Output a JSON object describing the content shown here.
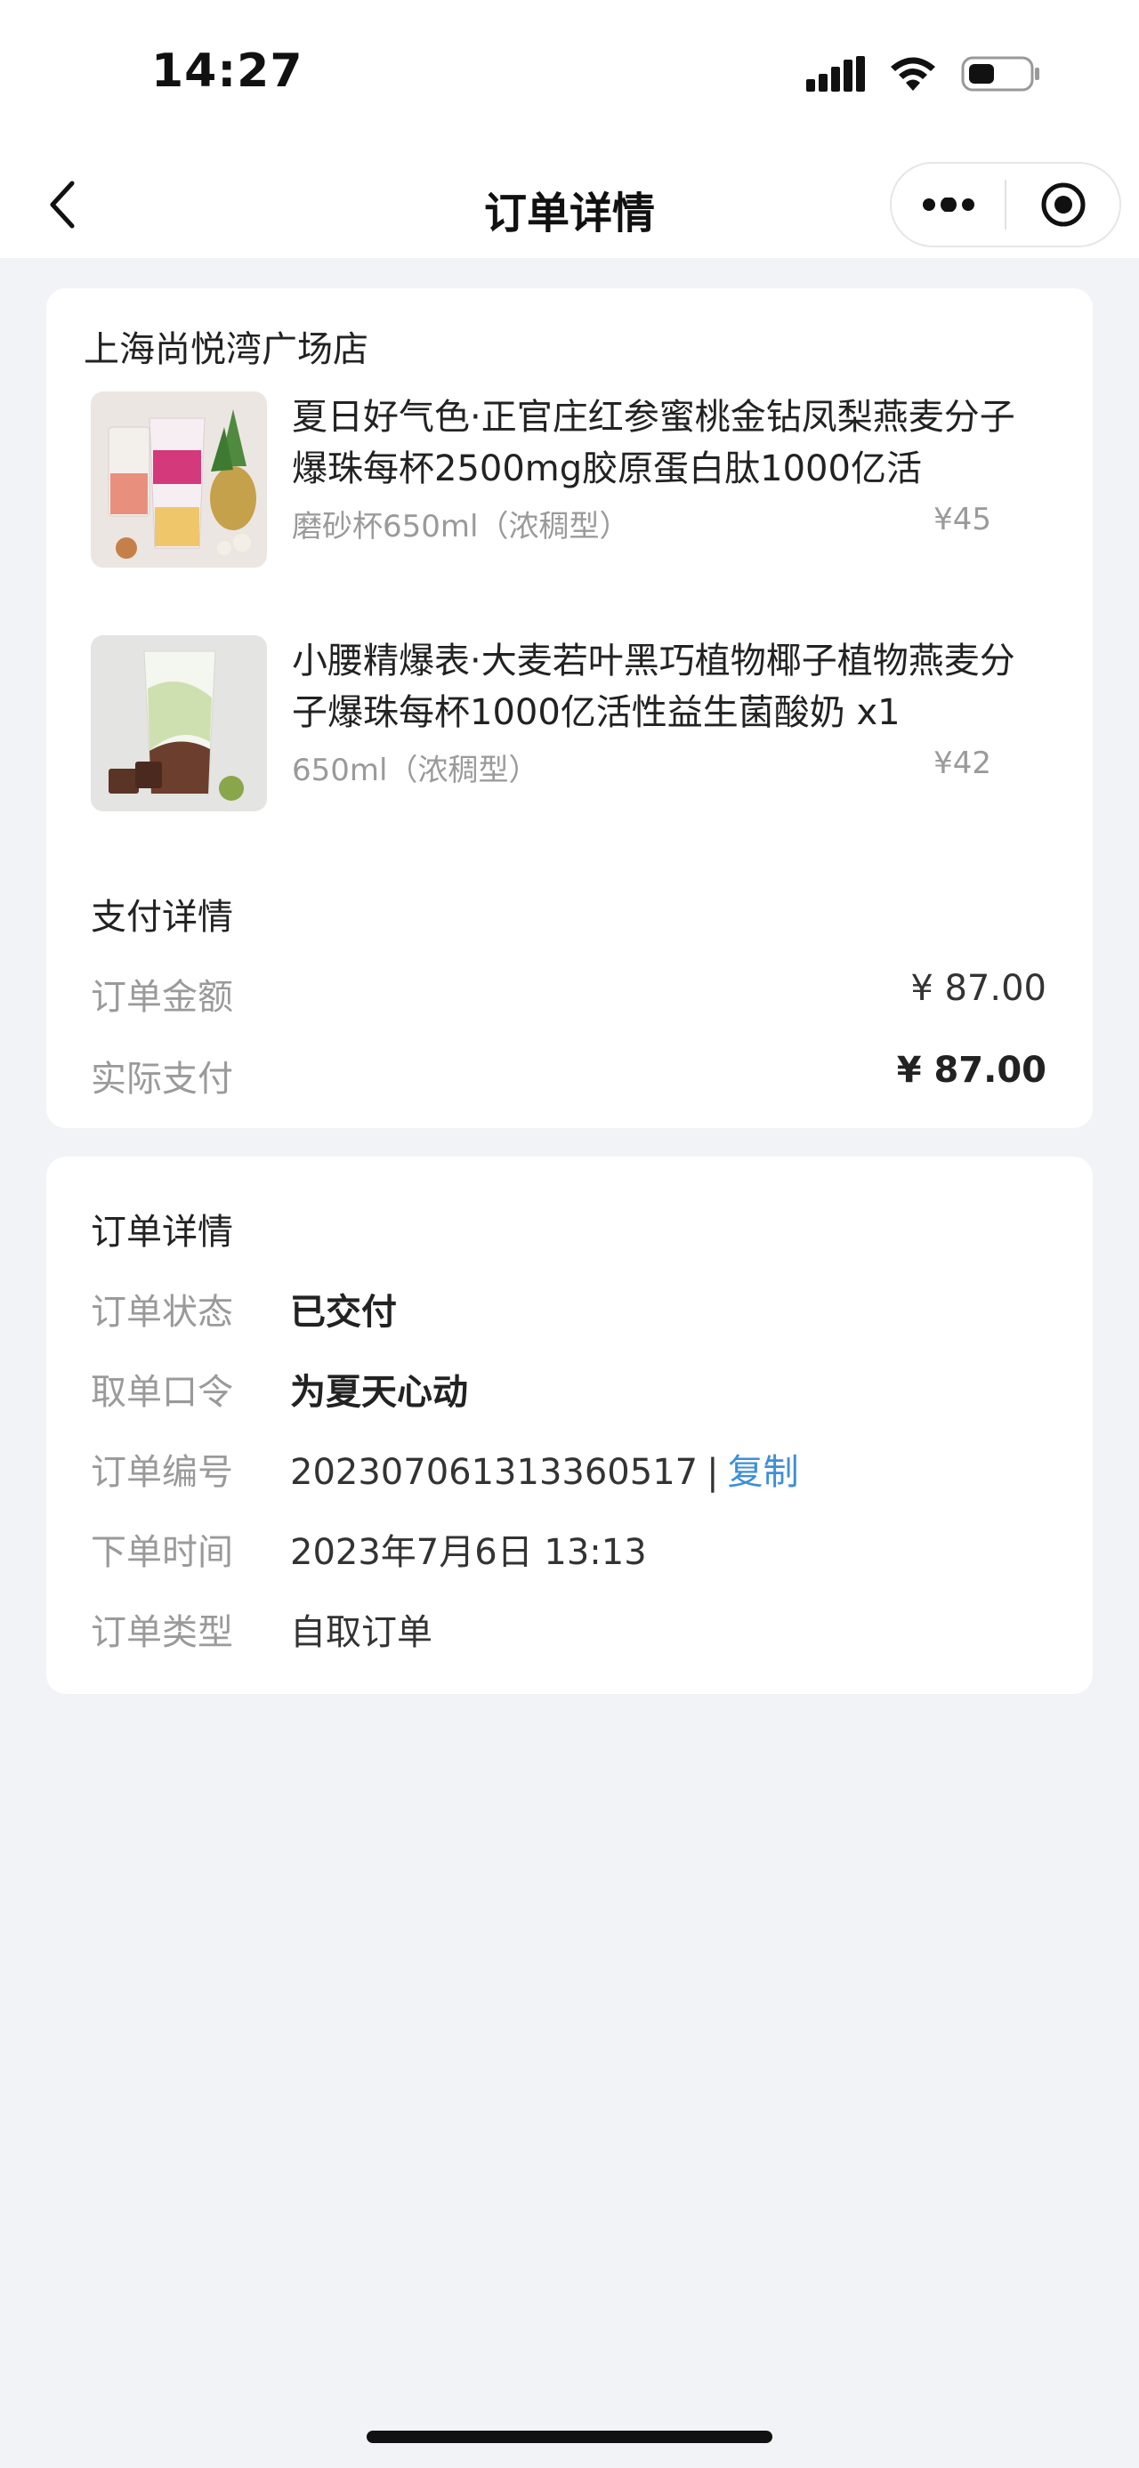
{
  "status_bar": {
    "time": "14:27"
  },
  "nav": {
    "title": "订单详情"
  },
  "store": {
    "name": "上海尚悦湾广场店"
  },
  "products": [
    {
      "name": "夏日好气色·正官庄红参蜜桃金钻凤梨燕麦分子爆珠每杯2500mg胶原蛋白肽1000亿活",
      "spec": "磨砂杯650ml（浓稠型）",
      "price": "¥45"
    },
    {
      "name": "小腰精爆表·大麦若叶黑巧植物椰子植物燕麦分子爆珠每杯1000亿活性益生菌酸奶 x1",
      "spec": "650ml（浓稠型）",
      "price": "¥42"
    }
  ],
  "payment": {
    "title": "支付详情",
    "order_amount_label": "订单金额",
    "order_amount": "¥ 87.00",
    "actual_paid_label": "实际支付",
    "actual_paid": "¥ 87.00"
  },
  "order": {
    "title": "订单详情",
    "status_label": "订单状态",
    "status": "已交付",
    "code_label": "取单口令",
    "code": "为夏天心动",
    "number_label": "订单编号",
    "number": "20230706131336051​7",
    "copy_label": "复制",
    "time_label": "下单时间",
    "time": "2023年7月6日 13:13",
    "type_label": "订单类型",
    "type": "自取订单"
  },
  "colors": {
    "link": "#3d8fd8",
    "background": "#f2f3f7"
  },
  "icons": [
    "signal-icon",
    "wifi-icon",
    "battery-icon",
    "back-icon",
    "more-icon",
    "record-icon"
  ]
}
